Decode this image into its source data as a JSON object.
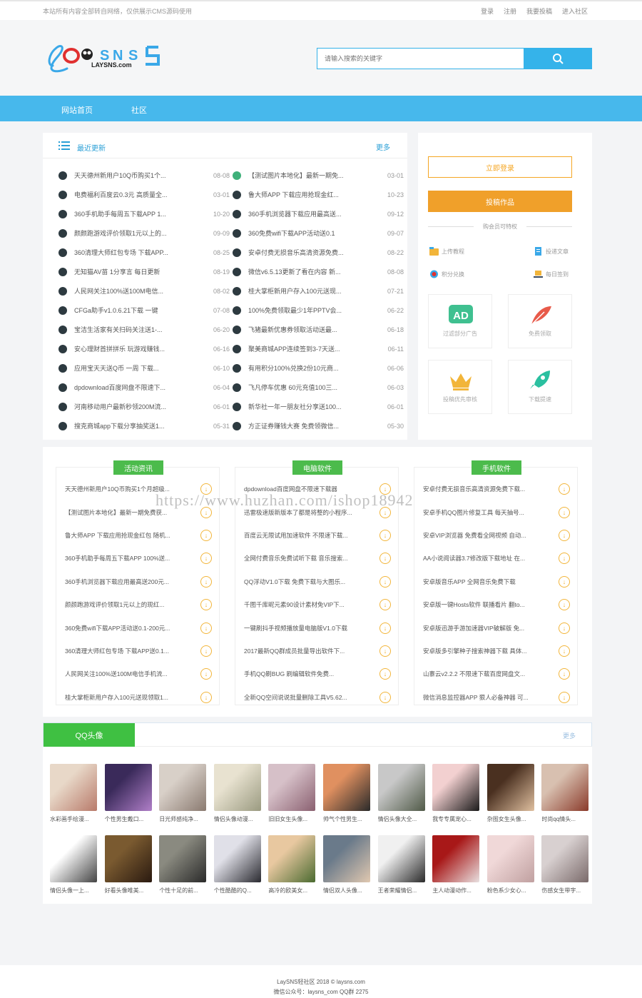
{
  "topbar": {
    "notice": "本站所有内容全部转自网络，仅供展示CMS源码使用",
    "links": [
      "登录",
      "注册",
      "我要投稿",
      "进入社区"
    ]
  },
  "brand": {
    "logo_sub": "LAYSNS.com"
  },
  "search": {
    "placeholder": "请输入搜索的关键字"
  },
  "nav": {
    "items": [
      "网站首页",
      "社区"
    ]
  },
  "updates": {
    "title": "最近更新",
    "more": "更多",
    "left": [
      {
        "t": "天天德州新用户10Q币购买1个...",
        "d": "08-08"
      },
      {
        "t": "电费福利百度云0.3元 高质量全...",
        "d": "03-01"
      },
      {
        "t": "360手机助手每周五下载APP 1...",
        "d": "10-20"
      },
      {
        "t": "颜颜跑游戏评价领取1元以上的...",
        "d": "09-09"
      },
      {
        "t": "360清理大师红包专场 下载APP...",
        "d": "08-25"
      },
      {
        "t": "无知猫AV苗 1分享言 每日更新",
        "d": "08-19"
      },
      {
        "t": "人民网关注100%送100M电信...",
        "d": "08-02"
      },
      {
        "t": "CFGa助手v1.0.6.21下载 一键",
        "d": "07-08"
      },
      {
        "t": "宝洁生活家有关扫码关注送1-...",
        "d": "06-20"
      },
      {
        "t": "安心理财首拼拼乐 玩游戏赚钱...",
        "d": "06-16"
      },
      {
        "t": "应用宝天天送Q币 一周 下载...",
        "d": "06-10"
      },
      {
        "t": "dpdownload百度网盘不限速下...",
        "d": "06-04"
      },
      {
        "t": "河南移动用户最新秒领200M流...",
        "d": "06-01"
      },
      {
        "t": "搜克商城app下载分享抽奖送1...",
        "d": "05-31"
      }
    ],
    "right": [
      {
        "t": "【测试图片本地化】最新一期免...",
        "d": "03-01"
      },
      {
        "t": "鲁大师APP 下载应用抢现金红...",
        "d": "10-23"
      },
      {
        "t": "360手机浏览器下载应用最高送...",
        "d": "09-12"
      },
      {
        "t": "360免费wifi下载APP活动送0.1",
        "d": "09-07"
      },
      {
        "t": "安卓付费无损音乐高清资源免费...",
        "d": "08-22"
      },
      {
        "t": "微信v6.5.13更新了看在内容 新...",
        "d": "08-08"
      },
      {
        "t": "桂大掌柜新用户存入100元送现...",
        "d": "07-21"
      },
      {
        "t": "100%免费领取最少1年PPTV会...",
        "d": "06-22"
      },
      {
        "t": "飞猪最新优惠券领取活动送最...",
        "d": "06-18"
      },
      {
        "t": "聚美商城APP连续签到3-7天送...",
        "d": "06-11"
      },
      {
        "t": "有用积分100%兑换2份10元商...",
        "d": "06-06"
      },
      {
        "t": "飞凡停车优惠 60元充值100三...",
        "d": "06-03"
      },
      {
        "t": "新华社一年一朋友社分享送100...",
        "d": "06-01"
      },
      {
        "t": "方正证券赚钱大赛 免费领微信...",
        "d": "05-30"
      }
    ]
  },
  "side": {
    "login": "立即登录",
    "submit": "投稿作品",
    "privilege": "购会员可特权",
    "links": [
      "上传教程",
      "投递文章",
      "积分兑换",
      "每日签到"
    ],
    "cards": [
      "过滤部分广告",
      "免费领取",
      "投稿优先审核",
      "下载提速"
    ]
  },
  "categories": [
    {
      "tag": "活动资讯",
      "items": [
        "天天德州新用户10Q币购买1个月超级...",
        "【测试图片本地化】最新一期免费获...",
        "鲁大师APP 下载应用抢现金红包 随机...",
        "360手机助手每周五下载APP 100%送...",
        "360手机浏览器下载应用最高送200元...",
        "颜颜跑游戏评价领取1元以上的现红...",
        "360免费wifi下载APP活动送0.1-200元...",
        "360清理大师红包专场 下载APP送0.1...",
        "人民网关注100%送100M电信手机流...",
        "桂大掌柜新用户存入100元送现领取1..."
      ]
    },
    {
      "tag": "电脑软件",
      "items": [
        "dpdownload百度网盘不限速下载器",
        "迅雷极速版新版本了都是将整的小程序...",
        "百度云无限试用加速软件 不限速下载...",
        "全网付费音乐免费试听下载 音乐搜索...",
        "QQ浮动V1.0下载 免费下载与大图乐...",
        "千图千库昵元素90设计素材免VIP下...",
        "一键刷抖手视频播放量电脑版V1.0下载",
        "2017最新QQ群成员批量导出软件下...",
        "手机QQ刷BUG 刷编辑软件免费...",
        "全新QQ空间说说批量删除工具V5.62..."
      ]
    },
    {
      "tag": "手机软件",
      "items": [
        "安卓付费无损音乐高清资源免费下载...",
        "安卓手机QQ图片修复工具 每天抽号...",
        "安卓VIP浏览器 免费看全网视频 自动...",
        "AA小说阅读器3.7修改版下载地址 在...",
        "安卓版音乐APP 全网音乐免费下载",
        "安卓版一键Hosts软件 联播看片 翻to...",
        "安卓版迅游手游加速器VIP破解版 免...",
        "安卓版多引擎种子搜索神器下载 具体...",
        "山寨云v2.2.2 不限速下载百度网盘文...",
        "微信消息监控器APP 狠人必备神器 可..."
      ]
    }
  ],
  "watermark": "https://www.huzhan.com/ishop18942",
  "qq": {
    "title": "QQ头像",
    "more": "更多",
    "items": [
      {
        "cap": "水彩画手绘漫...",
        "c1": "#e8d8c8",
        "c2": "#b87a6a"
      },
      {
        "cap": "个性男生戴口...",
        "c1": "#3a2a5a",
        "c2": "#b07fc8"
      },
      {
        "cap": "日光师感纯净...",
        "c1": "#d8d0c8",
        "c2": "#8a7a70"
      },
      {
        "cap": "情侣头像动漫...",
        "c1": "#e8e2d0",
        "c2": "#9a9a80"
      },
      {
        "cap": "旧旧女生头像...",
        "c1": "#d6c0c8",
        "c2": "#8a6070"
      },
      {
        "cap": "帅气个性男生...",
        "c1": "#e09060",
        "c2": "#2a2a2a"
      },
      {
        "cap": "情侣头像大全...",
        "c1": "#c8c8c8",
        "c2": "#505a48"
      },
      {
        "cap": "我专专属宠心...",
        "c1": "#f2d0d0",
        "c2": "#1a1a1a"
      },
      {
        "cap": "杂图女生头像...",
        "c1": "#4a3020",
        "c2": "#e0c0a0"
      },
      {
        "cap": "时尚qq情头...",
        "c1": "#d8c0b0",
        "c2": "#8a3a2a"
      },
      {
        "cap": "情侣头像一上...",
        "c1": "#ffffff",
        "c2": "#444444"
      },
      {
        "cap": "好看头像唯美...",
        "c1": "#7a5a30",
        "c2": "#2a1a10"
      },
      {
        "cap": "个性十足的前...",
        "c1": "#8a8a80",
        "c2": "#2a2a2a"
      },
      {
        "cap": "个性酷酷的Q...",
        "c1": "#e0e0e8",
        "c2": "#2a2a30"
      },
      {
        "cap": "高冷的欧美女...",
        "c1": "#e8c8a0",
        "c2": "#4a6a30"
      },
      {
        "cap": "情侣双人头像...",
        "c1": "#6a7a8a",
        "c2": "#e0c8b0"
      },
      {
        "cap": "王者荣耀情侣...",
        "c1": "#f0f0f0",
        "c2": "#2a2a2a"
      },
      {
        "cap": "主人动漫动作...",
        "c1": "#a81818",
        "c2": "#e8e0e0"
      },
      {
        "cap": "粉色系少女心...",
        "c1": "#f0d8d8",
        "c2": "#c0a0a0"
      },
      {
        "cap": "伤感女生带字...",
        "c1": "#d8d0d0",
        "c2": "#7a6a6a"
      }
    ]
  },
  "footer": {
    "line1": "LaySNS轻社区 2018 © laysns.com",
    "line2": "微信公众号：laysns_com QQ群 2275"
  }
}
